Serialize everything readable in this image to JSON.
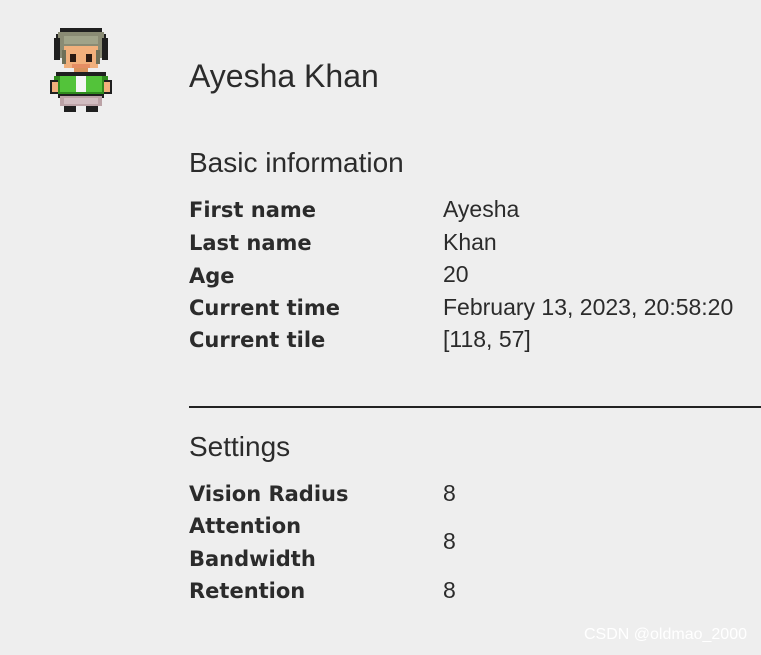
{
  "persona": {
    "name": "Ayesha Khan",
    "avatar_icon": "pixel-character-icon"
  },
  "basic_info": {
    "title": "Basic information",
    "fields": [
      {
        "label": "First name",
        "value": "Ayesha"
      },
      {
        "label": "Last name",
        "value": "Khan"
      },
      {
        "label": "Age",
        "value": "20"
      },
      {
        "label": "Current time",
        "value": "February 13, 2023, 20:58:20"
      },
      {
        "label": "Current tile",
        "value": "[118, 57]"
      }
    ]
  },
  "settings": {
    "title": "Settings",
    "fields": [
      {
        "label": "Vision Radius",
        "value": "8"
      },
      {
        "label_line1": "Attention",
        "label_line2": "Bandwidth",
        "value": "8"
      },
      {
        "label": "Retention",
        "value": "8"
      }
    ]
  },
  "watermark": "CSDN @oldmao_2000",
  "colors": {
    "background": "#eeeeee",
    "text": "#2b2b2b",
    "divider": "#222222"
  }
}
